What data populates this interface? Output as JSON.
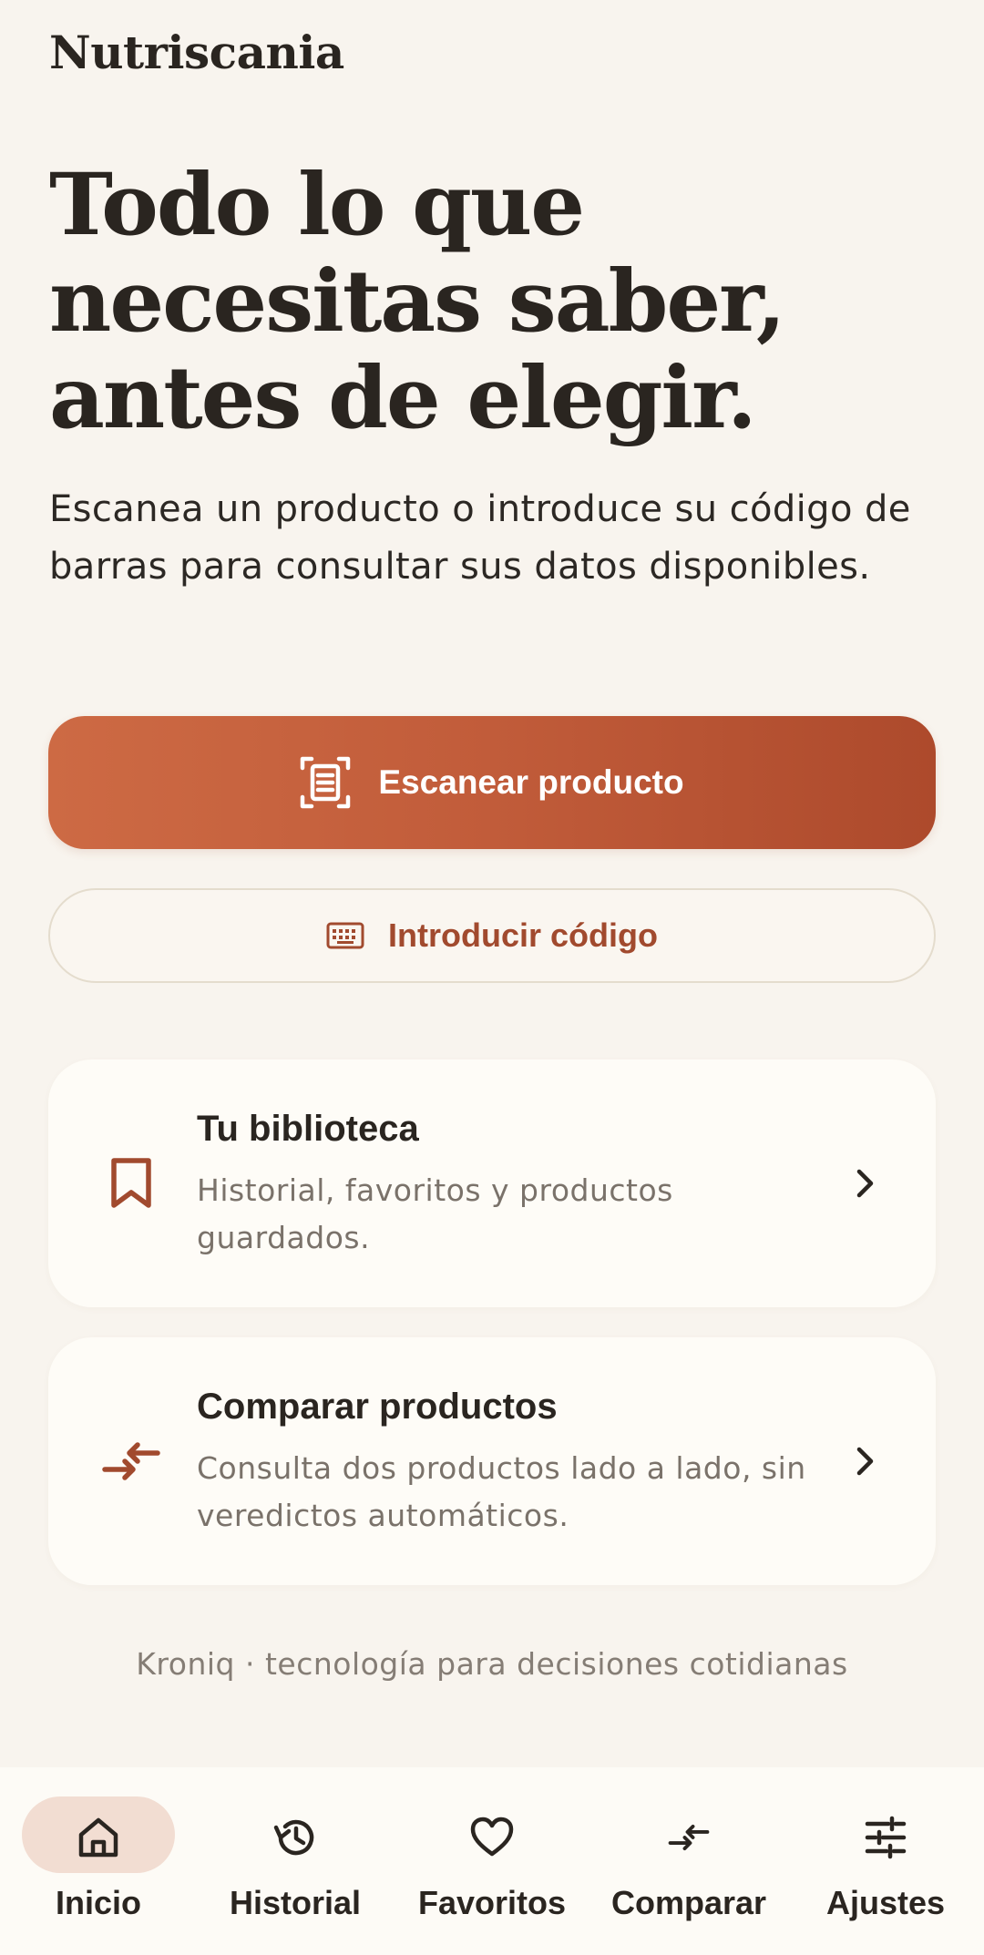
{
  "app": {
    "brand": "Nutriscania"
  },
  "hero": {
    "headline_lines": [
      "Todo lo que",
      "necesitas saber,",
      "antes de elegir."
    ],
    "subtitle": "Escanea un producto o introduce su código de barras para consultar sus datos disponibles."
  },
  "actions": {
    "scan_label": "Escanear producto",
    "scan_icon": "scan-document-icon",
    "code_label": "Introducir código",
    "code_icon": "keyboard-icon"
  },
  "cards": [
    {
      "title": "Tu biblioteca",
      "description": "Historial, favoritos y productos guardados.",
      "icon": "bookmark-icon"
    },
    {
      "title": "Comparar productos",
      "description": "Consulta dos productos lado a lado, sin veredictos automáticos.",
      "icon": "compare-arrows-icon"
    }
  ],
  "footer": {
    "note": "Kroniq · tecnología para decisiones cotidianas"
  },
  "nav": {
    "active": "Inicio",
    "items": [
      {
        "label": "Inicio",
        "icon": "home-icon"
      },
      {
        "label": "Historial",
        "icon": "history-icon"
      },
      {
        "label": "Favoritos",
        "icon": "heart-icon"
      },
      {
        "label": "Comparar",
        "icon": "compare-arrows-icon"
      },
      {
        "label": "Ajustes",
        "icon": "sliders-icon"
      }
    ]
  },
  "colors": {
    "background": "#f8f4ee",
    "accent": "#c15c3a",
    "accent_dark": "#a14a2e",
    "card": "#fefcf7",
    "nav_active": "#f2ddd2",
    "text": "#2a2520",
    "muted": "#7a726a"
  }
}
